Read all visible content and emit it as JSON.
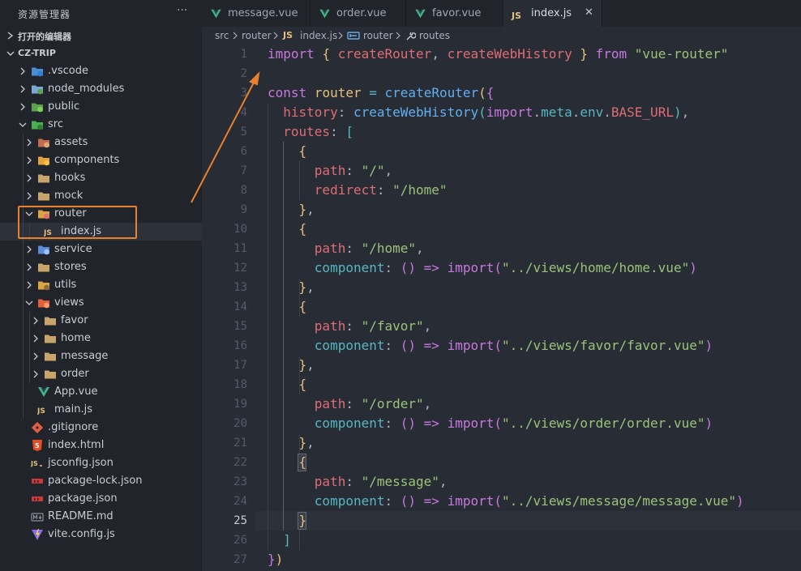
{
  "explorer": {
    "title": "资源管理器",
    "more": "···"
  },
  "sections": {
    "open_editors": "打开的编辑器",
    "project": "CZ-TRIP"
  },
  "tree": [
    {
      "name": ".vscode",
      "kind": "folder",
      "depth": 1,
      "open": false,
      "icon": "vscode-folder-icon"
    },
    {
      "name": "node_modules",
      "kind": "folder",
      "depth": 1,
      "open": false,
      "icon": "node-folder-icon"
    },
    {
      "name": "public",
      "kind": "folder",
      "depth": 1,
      "open": false,
      "icon": "public-folder-icon"
    },
    {
      "name": "src",
      "kind": "folder",
      "depth": 1,
      "open": true,
      "icon": "src-folder-icon"
    },
    {
      "name": "assets",
      "kind": "folder",
      "depth": 2,
      "open": false,
      "icon": "assets-folder-icon"
    },
    {
      "name": "components",
      "kind": "folder",
      "depth": 2,
      "open": false,
      "icon": "components-folder-icon"
    },
    {
      "name": "hooks",
      "kind": "folder",
      "depth": 2,
      "open": false,
      "icon": "folder-icon"
    },
    {
      "name": "mock",
      "kind": "folder",
      "depth": 2,
      "open": false,
      "icon": "folder-icon"
    },
    {
      "name": "router",
      "kind": "folder",
      "depth": 2,
      "open": true,
      "icon": "router-folder-icon"
    },
    {
      "name": "index.js",
      "kind": "file",
      "depth": 3,
      "icon": "js-file-icon",
      "selected": true
    },
    {
      "name": "service",
      "kind": "folder",
      "depth": 2,
      "open": false,
      "icon": "service-folder-icon"
    },
    {
      "name": "stores",
      "kind": "folder",
      "depth": 2,
      "open": false,
      "icon": "folder-icon"
    },
    {
      "name": "utils",
      "kind": "folder",
      "depth": 2,
      "open": false,
      "icon": "utils-folder-icon"
    },
    {
      "name": "views",
      "kind": "folder",
      "depth": 2,
      "open": true,
      "icon": "views-folder-icon"
    },
    {
      "name": "favor",
      "kind": "folder",
      "depth": 3,
      "open": false,
      "icon": "folder-icon"
    },
    {
      "name": "home",
      "kind": "folder",
      "depth": 3,
      "open": false,
      "icon": "folder-icon"
    },
    {
      "name": "message",
      "kind": "folder",
      "depth": 3,
      "open": false,
      "icon": "folder-icon"
    },
    {
      "name": "order",
      "kind": "folder",
      "depth": 3,
      "open": false,
      "icon": "folder-icon"
    },
    {
      "name": "App.vue",
      "kind": "file",
      "depth": 2,
      "icon": "vue-file-icon"
    },
    {
      "name": "main.js",
      "kind": "file",
      "depth": 2,
      "icon": "js-file-icon"
    },
    {
      "name": ".gitignore",
      "kind": "file",
      "depth": 1,
      "icon": "git-file-icon"
    },
    {
      "name": "index.html",
      "kind": "file",
      "depth": 1,
      "icon": "html-file-icon"
    },
    {
      "name": "jsconfig.json",
      "kind": "file",
      "depth": 1,
      "icon": "jsconfig-file-icon"
    },
    {
      "name": "package-lock.json",
      "kind": "file",
      "depth": 1,
      "icon": "npm-file-icon"
    },
    {
      "name": "package.json",
      "kind": "file",
      "depth": 1,
      "icon": "npm-file-icon"
    },
    {
      "name": "README.md",
      "kind": "file",
      "depth": 1,
      "icon": "markdown-file-icon"
    },
    {
      "name": "vite.config.js",
      "kind": "file",
      "depth": 1,
      "icon": "vite-file-icon"
    }
  ],
  "tabs": [
    {
      "label": "message.vue",
      "icon": "vue-file-icon",
      "active": false
    },
    {
      "label": "order.vue",
      "icon": "vue-file-icon",
      "active": false
    },
    {
      "label": "favor.vue",
      "icon": "vue-file-icon",
      "active": false
    },
    {
      "label": "index.js",
      "icon": "js-file-icon",
      "active": true,
      "close": "✕"
    }
  ],
  "js_badge": "JS",
  "breadcrumb": [
    "src",
    "router",
    "index.js",
    "router",
    "routes"
  ],
  "current_line": 25,
  "code": [
    [
      [
        "kw",
        "import"
      ],
      [
        "pun",
        " "
      ],
      [
        "br1",
        "{"
      ],
      [
        "pun",
        " "
      ],
      [
        "prop",
        "createRouter"
      ],
      [
        "pun",
        ", "
      ],
      [
        "prop",
        "createWebHistory"
      ],
      [
        "pun",
        " "
      ],
      [
        "br1",
        "}"
      ],
      [
        "pun",
        " "
      ],
      [
        "kw",
        "from"
      ],
      [
        "pun",
        " "
      ],
      [
        "str",
        "\"vue-router\""
      ]
    ],
    [],
    [
      [
        "kw",
        "const"
      ],
      [
        "pun",
        " "
      ],
      [
        "var",
        "router"
      ],
      [
        "pun",
        " "
      ],
      [
        "op",
        "="
      ],
      [
        "pun",
        " "
      ],
      [
        "fn",
        "createRouter"
      ],
      [
        "br1",
        "("
      ],
      [
        "br2",
        "{"
      ]
    ],
    [
      [
        "pun",
        "  "
      ],
      [
        "prop",
        "history"
      ],
      [
        "pun",
        ": "
      ],
      [
        "fn",
        "createWebHistory"
      ],
      [
        "br3",
        "("
      ],
      [
        "kw",
        "import"
      ],
      [
        "pun",
        "."
      ],
      [
        "cyan",
        "meta"
      ],
      [
        "pun",
        "."
      ],
      [
        "cyan",
        "env"
      ],
      [
        "pun",
        "."
      ],
      [
        "prop",
        "BASE_URL"
      ],
      [
        "br3",
        ")"
      ],
      [
        "pun",
        ","
      ]
    ],
    [
      [
        "pun",
        "  "
      ],
      [
        "prop",
        "routes"
      ],
      [
        "pun",
        ": "
      ],
      [
        "br3",
        "["
      ]
    ],
    [
      [
        "pun",
        "    "
      ],
      [
        "br1",
        "{"
      ]
    ],
    [
      [
        "pun",
        "      "
      ],
      [
        "prop",
        "path"
      ],
      [
        "pun",
        ": "
      ],
      [
        "str",
        "\"/\""
      ],
      [
        "pun",
        ","
      ]
    ],
    [
      [
        "pun",
        "      "
      ],
      [
        "prop",
        "redirect"
      ],
      [
        "pun",
        ": "
      ],
      [
        "str",
        "\"/home\""
      ]
    ],
    [
      [
        "pun",
        "    "
      ],
      [
        "br1",
        "}"
      ],
      [
        "pun",
        ","
      ]
    ],
    [
      [
        "pun",
        "    "
      ],
      [
        "br1",
        "{"
      ]
    ],
    [
      [
        "pun",
        "      "
      ],
      [
        "prop",
        "path"
      ],
      [
        "pun",
        ": "
      ],
      [
        "str",
        "\"/home\""
      ],
      [
        "pun",
        ","
      ]
    ],
    [
      [
        "pun",
        "      "
      ],
      [
        "cyan",
        "component"
      ],
      [
        "pun",
        ": "
      ],
      [
        "br2",
        "()"
      ],
      [
        "pun",
        " "
      ],
      [
        "kw",
        "=>"
      ],
      [
        "pun",
        " "
      ],
      [
        "kw",
        "import"
      ],
      [
        "br2",
        "("
      ],
      [
        "str",
        "\"../views/home/home.vue\""
      ],
      [
        "br2",
        ")"
      ]
    ],
    [
      [
        "pun",
        "    "
      ],
      [
        "br1",
        "}"
      ],
      [
        "pun",
        ","
      ]
    ],
    [
      [
        "pun",
        "    "
      ],
      [
        "br1",
        "{"
      ]
    ],
    [
      [
        "pun",
        "      "
      ],
      [
        "prop",
        "path"
      ],
      [
        "pun",
        ": "
      ],
      [
        "str",
        "\"/favor\""
      ],
      [
        "pun",
        ","
      ]
    ],
    [
      [
        "pun",
        "      "
      ],
      [
        "cyan",
        "component"
      ],
      [
        "pun",
        ": "
      ],
      [
        "br2",
        "()"
      ],
      [
        "pun",
        " "
      ],
      [
        "kw",
        "=>"
      ],
      [
        "pun",
        " "
      ],
      [
        "kw",
        "import"
      ],
      [
        "br2",
        "("
      ],
      [
        "str",
        "\"../views/favor/favor.vue\""
      ],
      [
        "br2",
        ")"
      ]
    ],
    [
      [
        "pun",
        "    "
      ],
      [
        "br1",
        "}"
      ],
      [
        "pun",
        ","
      ]
    ],
    [
      [
        "pun",
        "    "
      ],
      [
        "br1",
        "{"
      ]
    ],
    [
      [
        "pun",
        "      "
      ],
      [
        "prop",
        "path"
      ],
      [
        "pun",
        ": "
      ],
      [
        "str",
        "\"/order\""
      ],
      [
        "pun",
        ","
      ]
    ],
    [
      [
        "pun",
        "      "
      ],
      [
        "cyan",
        "component"
      ],
      [
        "pun",
        ": "
      ],
      [
        "br2",
        "()"
      ],
      [
        "pun",
        " "
      ],
      [
        "kw",
        "=>"
      ],
      [
        "pun",
        " "
      ],
      [
        "kw",
        "import"
      ],
      [
        "br2",
        "("
      ],
      [
        "str",
        "\"../views/order/order.vue\""
      ],
      [
        "br2",
        ")"
      ]
    ],
    [
      [
        "pun",
        "    "
      ],
      [
        "br1",
        "}"
      ],
      [
        "pun",
        ","
      ]
    ],
    [
      [
        "pun",
        "    "
      ],
      [
        "br1",
        "{"
      ]
    ],
    [
      [
        "pun",
        "      "
      ],
      [
        "prop",
        "path"
      ],
      [
        "pun",
        ": "
      ],
      [
        "str",
        "\"/message\""
      ],
      [
        "pun",
        ","
      ]
    ],
    [
      [
        "pun",
        "      "
      ],
      [
        "cyan",
        "component"
      ],
      [
        "pun",
        ": "
      ],
      [
        "br2",
        "()"
      ],
      [
        "pun",
        " "
      ],
      [
        "kw",
        "=>"
      ],
      [
        "pun",
        " "
      ],
      [
        "kw",
        "import"
      ],
      [
        "br2",
        "("
      ],
      [
        "str",
        "\"../views/message/message.vue\""
      ],
      [
        "br2",
        ")"
      ]
    ],
    [
      [
        "pun",
        "    "
      ],
      [
        "br1",
        "}"
      ]
    ],
    [
      [
        "pun",
        "  "
      ],
      [
        "br3",
        "]"
      ]
    ],
    [
      [
        "br2",
        "}"
      ],
      [
        "br1",
        ")"
      ]
    ]
  ],
  "colors": {
    "accent": "#e8812f",
    "vue": "#41b883",
    "js": "#f1e05a"
  }
}
